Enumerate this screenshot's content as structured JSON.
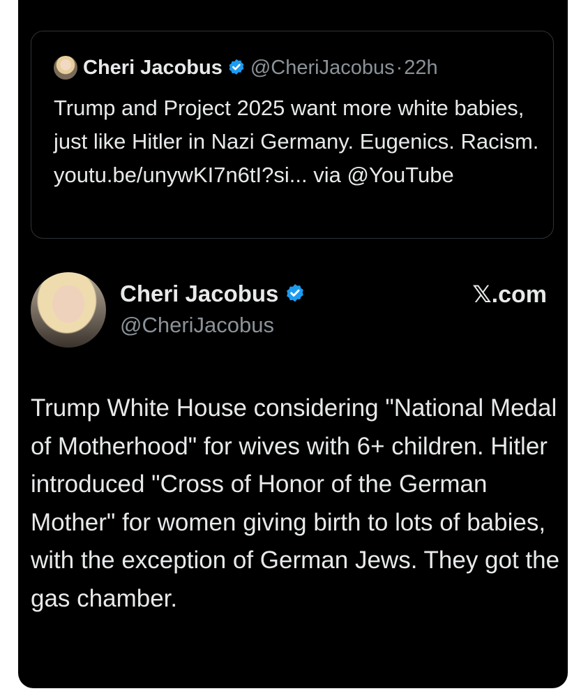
{
  "quoted_tweet": {
    "name": "Cheri Jacobus",
    "handle": "@CheriJacobus",
    "separator": "·",
    "time": "22h",
    "text": "Trump and Project 2025 want more white babies, just like Hitler in Nazi Germany. Eugenics. Racism. youtu.be/unywKI7n6tI?si... via @YouTube"
  },
  "main_tweet": {
    "name": "Cheri Jacobus",
    "handle": "@CheriJacobus",
    "source": "𝕏.com",
    "text": "Trump White House considering \"National Medal of Motherhood\" for wives with 6+ children. Hitler introduced \"Cross of Honor of the German Mother\" for women giving birth to lots of babies, with the exception of German Jews. They got the gas chamber."
  },
  "icons": {
    "verified": "verified-badge-icon",
    "avatar": "profile-photo"
  },
  "colors": {
    "background": "#000000",
    "text": "#e7e9ea",
    "muted": "#8b9298",
    "verified": "#1d9bf0",
    "border": "#2f3336"
  }
}
